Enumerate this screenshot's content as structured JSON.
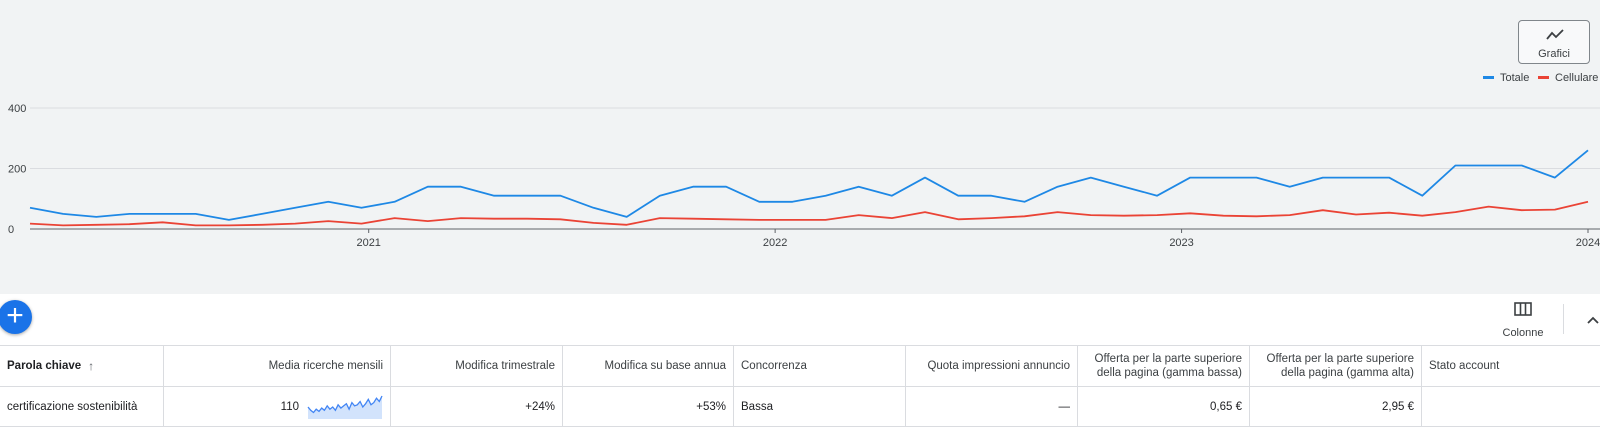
{
  "chart_controls": {
    "grafici_label": "Grafici",
    "icon": "trend-line-icon"
  },
  "legend": [
    {
      "label": "Totale",
      "color": "#1e88e5"
    },
    {
      "label": "Cellulare",
      "color": "#ea4335"
    }
  ],
  "chart_data": {
    "type": "line",
    "y_ticks": [
      "0",
      "200",
      "400"
    ],
    "ylim": [
      0,
      400
    ],
    "x_ticks": [
      "2021",
      "2022",
      "2023",
      "2024"
    ],
    "x_start": "2020-03",
    "x_end": "2024-01",
    "grid": true,
    "legend_position": "top-right",
    "series": [
      {
        "name": "Totale",
        "color": "#1e88e5",
        "values": [
          70,
          50,
          40,
          50,
          50,
          50,
          30,
          50,
          70,
          90,
          70,
          90,
          140,
          140,
          110,
          110,
          110,
          70,
          40,
          110,
          140,
          140,
          90,
          90,
          110,
          140,
          110,
          170,
          110,
          110,
          90,
          140,
          170,
          140,
          110,
          170,
          170,
          170,
          140,
          170,
          170,
          170,
          110,
          210,
          210,
          210,
          170,
          260
        ]
      },
      {
        "name": "Cellulare",
        "color": "#ea4335",
        "values": [
          18,
          12,
          14,
          16,
          22,
          12,
          12,
          14,
          18,
          26,
          18,
          36,
          26,
          36,
          34,
          34,
          32,
          20,
          14,
          36,
          34,
          32,
          30,
          30,
          30,
          46,
          36,
          56,
          32,
          36,
          42,
          56,
          46,
          44,
          46,
          52,
          44,
          42,
          46,
          62,
          48,
          54,
          44,
          56,
          74,
          62,
          64,
          90
        ]
      }
    ]
  },
  "toolbar": {
    "add_label": "+",
    "columns_label": "Colonne"
  },
  "table": {
    "headers": [
      "Parola chiave",
      "Media ricerche mensili",
      "Modifica trimestrale",
      "Modifica su base annua",
      "Concorrenza",
      "Quota impressioni annuncio",
      "Offerta per la parte superiore della pagina (gamma bassa)",
      "Offerta per la parte superiore della pagina (gamma alta)",
      "Stato account"
    ],
    "header_lines": {
      "bid_low": [
        "Offerta per la parte superiore",
        "della pagina (gamma bassa)"
      ],
      "bid_high": [
        "Offerta per la parte superiore",
        "della pagina (gamma alta)"
      ]
    },
    "rows": [
      {
        "keyword": "certificazione sostenibilità",
        "avg_searches": "110",
        "qoq_change": "+24%",
        "yoy_change": "+53%",
        "competition": "Bassa",
        "impression_share": "—",
        "bid_low": "0,65 €",
        "bid_high": "2,95 €",
        "account_status": "",
        "trend": [
          20,
          14,
          10,
          16,
          12,
          18,
          14,
          22,
          16,
          20,
          14,
          24,
          18,
          22,
          26,
          16,
          28,
          22,
          24,
          30,
          20,
          26,
          34,
          24,
          28,
          36,
          30,
          40
        ]
      }
    ]
  }
}
